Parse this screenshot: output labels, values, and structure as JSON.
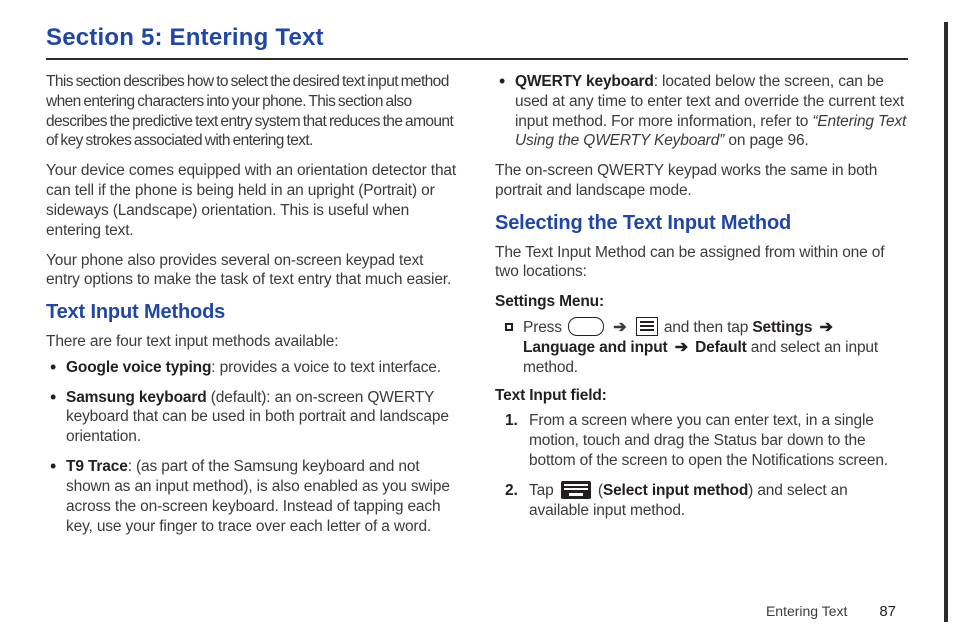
{
  "page": {
    "section_title": "Section 5: Entering Text",
    "intro_p1": "This section describes how to select the desired text input method when entering characters into your phone. This section also describes the predictive text entry system that reduces the amount of key strokes associated with entering text.",
    "intro_p2": "Your device comes equipped with an orientation detector that can tell if the phone is being held in an upright (Portrait) or sideways (Landscape) orientation. This is useful when entering text.",
    "intro_p3": "Your phone also provides several on-screen keypad text entry options to make the task of text entry that much easier.",
    "h2_methods": "Text Input Methods",
    "methods_intro": "There are four text input methods available:",
    "methods": {
      "m1_b": "Google voice typing",
      "m1_t": ": provides a voice to text interface.",
      "m2_b": "Samsung keyboard",
      "m2_t": " (default): an on-screen QWERTY keyboard that can be used in both portrait and landscape orientation.",
      "m3_b": "T9 Trace",
      "m3_t": ": (as part of the Samsung keyboard and not shown as an input method), is also enabled as you swipe across the on-screen keyboard. Instead of tapping each key, use your finger to trace over each letter of a word.",
      "m4_b": "QWERTY keyboard",
      "m4_t1": ": located below the screen, can be used at any time to enter text and override the current text input method. For more information, refer to ",
      "m4_ref": "“Entering Text Using the QWERTY Keyboard”",
      "m4_t2": " on page 96."
    },
    "note_qwerty": "The on-screen QWERTY keypad works the same in both portrait and landscape mode.",
    "h2_select": "Selecting the Text Input Method",
    "select_intro": "The Text Input Method can be assigned from within one of two locations:",
    "sub_settings": "Settings Menu:",
    "settings_step": {
      "press": "Press ",
      "then_tap": " and then tap ",
      "settings": "Settings ",
      "lang": "Language and input ",
      "default": " Default",
      "rest": " and select an input method."
    },
    "arrow": "➔",
    "sub_input": "Text Input field:",
    "steps": {
      "s1": "From a screen where you can enter text, in a single motion, touch and drag the Status bar down to the bottom of the screen to open the Notifications screen.",
      "s2_a": "Tap ",
      "s2_paren_open": " (",
      "s2_b": "Select input method",
      "s2_paren_close": ") and select an available input method."
    },
    "footer_label": "Entering Text",
    "footer_page": "87"
  }
}
